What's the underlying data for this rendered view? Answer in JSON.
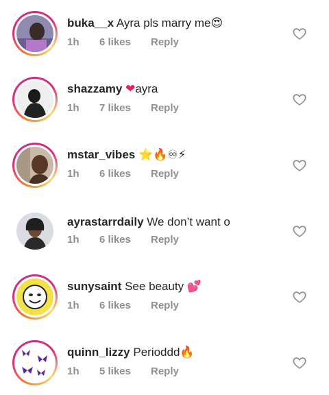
{
  "comments": [
    {
      "username": "buka__x",
      "text": "Ayra pls marry me",
      "emoji": "😍",
      "time": "1h",
      "likes": "6 likes",
      "reply": "Reply",
      "avatar_icon": "person-photo-avatar",
      "ring": true
    },
    {
      "username": "shazzamy",
      "text": "ayra",
      "emoji_before": "❤",
      "time": "1h",
      "likes": "7 likes",
      "reply": "Reply",
      "avatar_icon": "person-photo-avatar",
      "ring": true
    },
    {
      "username": "mstar_vibes",
      "text": "",
      "emoji": "⭐🔥♾⚡",
      "time": "1h",
      "likes": "6 likes",
      "reply": "Reply",
      "avatar_icon": "person-photo-avatar",
      "ring": true
    },
    {
      "username": "ayrastarrdaily",
      "text": "We don’t want o",
      "time": "1h",
      "likes": "6 likes",
      "reply": "Reply",
      "avatar_icon": "person-photo-avatar",
      "ring": false
    },
    {
      "username": "sunysaint",
      "text": "See beauty",
      "emoji": "💕",
      "time": "1h",
      "likes": "6 likes",
      "reply": "Reply",
      "avatar_icon": "cartoon-face-avatar",
      "ring": true
    },
    {
      "username": "quinn_lizzy",
      "text": "Perioddd",
      "emoji": "🔥",
      "time": "1h",
      "likes": "5 likes",
      "reply": "Reply",
      "avatar_icon": "butterflies-avatar",
      "ring": true
    }
  ],
  "colors": {
    "heart_outline": "#8e8e8e",
    "meta": "#8e8e8e",
    "text": "#262626",
    "red_heart": "#e0245e"
  }
}
